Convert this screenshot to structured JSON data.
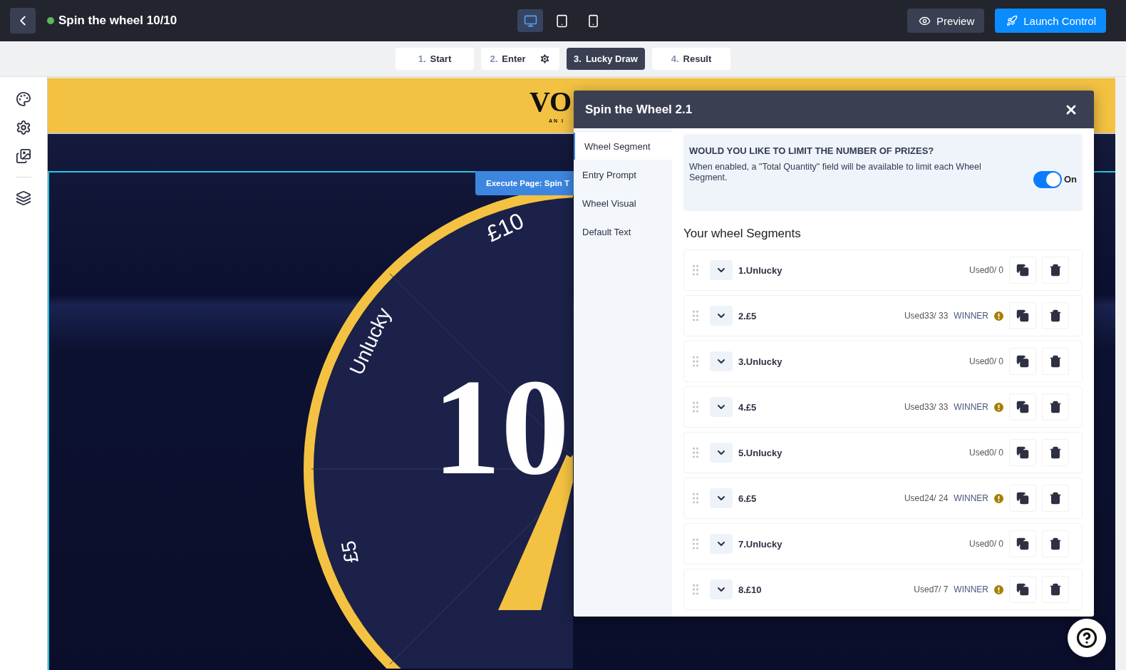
{
  "topbar": {
    "title": "Spin the wheel 10/10",
    "live": true,
    "devices": [
      {
        "kind": "desktop",
        "selected": true
      },
      {
        "kind": "tablet",
        "selected": false
      },
      {
        "kind": "mobile",
        "selected": false
      }
    ],
    "buttons": [
      {
        "kind": "preview",
        "label": "Preview"
      },
      {
        "kind": "launch",
        "label": "Launch Control"
      }
    ]
  },
  "steps": [
    {
      "number": "1.",
      "label": "Start",
      "selected": false,
      "settings": false
    },
    {
      "number": "2.",
      "label": "Enter",
      "selected": false,
      "settings": true
    },
    {
      "number": "3.",
      "label": "Lucky Draw",
      "selected": true,
      "settings": false
    },
    {
      "number": "4.",
      "label": "Result",
      "selected": false,
      "settings": false
    }
  ],
  "sidebar": [
    {
      "kind": "palette"
    },
    {
      "kind": "settings"
    },
    {
      "kind": "images"
    },
    {
      "kind": "stack"
    }
  ],
  "canvas": {
    "logo": "VO",
    "logo_subtitle": "AN I",
    "page_tag": "Execute Page: Spin T",
    "wheel_labels": [
      {
        "text": "£10",
        "kind": "top"
      },
      {
        "text": "Unlucky",
        "kind": "left"
      },
      {
        "text": "£5",
        "kind": "bottom"
      }
    ],
    "wheel_center": "10"
  },
  "modal": {
    "title": "Spin the Wheel 2.1",
    "nav": [
      {
        "label": "Wheel Segment",
        "selected": true
      },
      {
        "label": "Entry Prompt",
        "selected": false
      },
      {
        "label": "Wheel Visual",
        "selected": false
      },
      {
        "label": "Default Text",
        "selected": false
      }
    ],
    "limit_panel": {
      "heading": "WOULD YOU LIKE TO LIMIT THE NUMBER OF PRIZES?",
      "description": "When enabled, a \"Total Quantity\" field will be available to limit each Wheel Segment.",
      "on": true,
      "toggle_label": "On"
    },
    "segments_heading": "Your wheel Segments",
    "segments": [
      {
        "name": "1.Unlucky",
        "used": "Used0/ 0",
        "alert": false
      },
      {
        "name": "2.£5",
        "used": "Used33/ 33",
        "badge": "WINNER",
        "alert": true
      },
      {
        "name": "3.Unlucky",
        "used": "Used0/ 0",
        "alert": false
      },
      {
        "name": "4.£5",
        "used": "Used33/ 33",
        "badge": "WINNER",
        "alert": true
      },
      {
        "name": "5.Unlucky",
        "used": "Used0/ 0",
        "alert": false
      },
      {
        "name": "6.£5",
        "used": "Used24/ 24",
        "badge": "WINNER",
        "alert": true
      },
      {
        "name": "7.Unlucky",
        "used": "Used0/ 0",
        "alert": false
      },
      {
        "name": "8.£10",
        "used": "Used7/ 7",
        "badge": "WINNER",
        "alert": true
      }
    ]
  }
}
